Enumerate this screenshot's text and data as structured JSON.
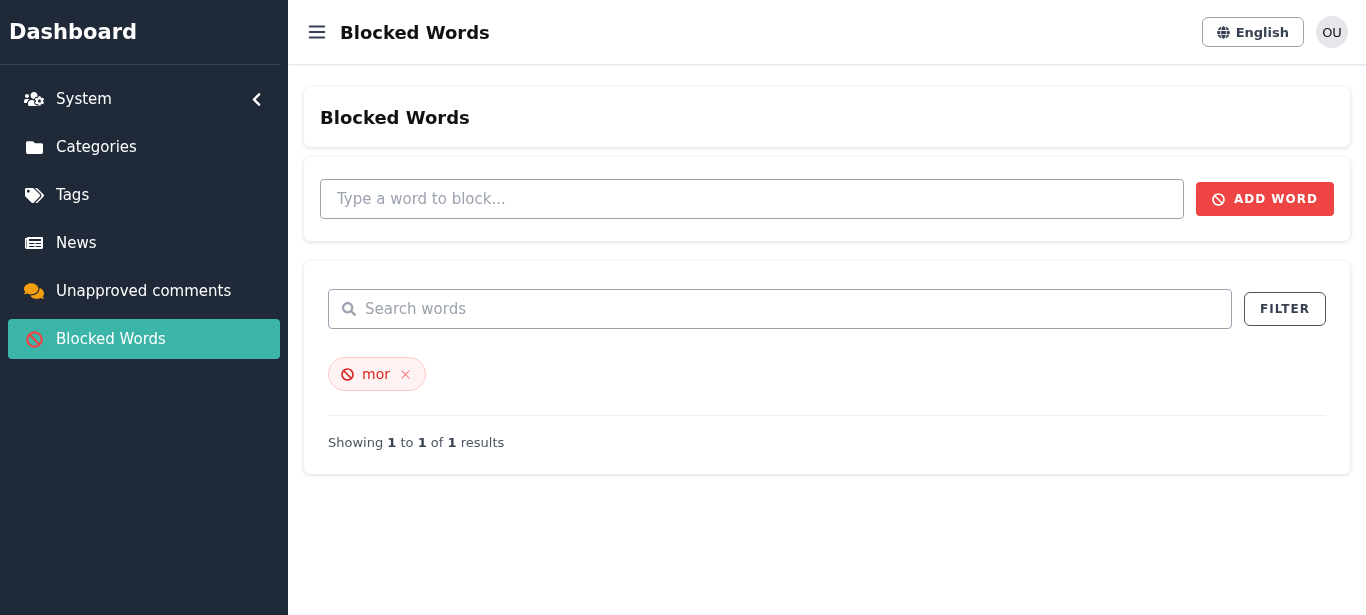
{
  "sidebar": {
    "title": "Dashboard",
    "items": [
      {
        "label": "System",
        "selected": false,
        "submenu": true
      },
      {
        "label": "Categories",
        "selected": false,
        "submenu": false
      },
      {
        "label": "Tags",
        "selected": false,
        "submenu": false
      },
      {
        "label": "News",
        "selected": false,
        "submenu": false
      },
      {
        "label": "Unapproved comments",
        "selected": false,
        "submenu": false
      },
      {
        "label": "Blocked Words",
        "selected": true,
        "submenu": false
      }
    ]
  },
  "header": {
    "title": "Blocked Words",
    "language": "English",
    "avatar": "OU"
  },
  "page_title": "Blocked Words",
  "add_form": {
    "placeholder": "Type a word to block...",
    "button": "ADD WORD"
  },
  "search": {
    "placeholder": "Search words",
    "button": "FILTER"
  },
  "words": [
    {
      "label": "mor"
    }
  ],
  "pagination": "Showing **1** to **1** of **1** results"
}
